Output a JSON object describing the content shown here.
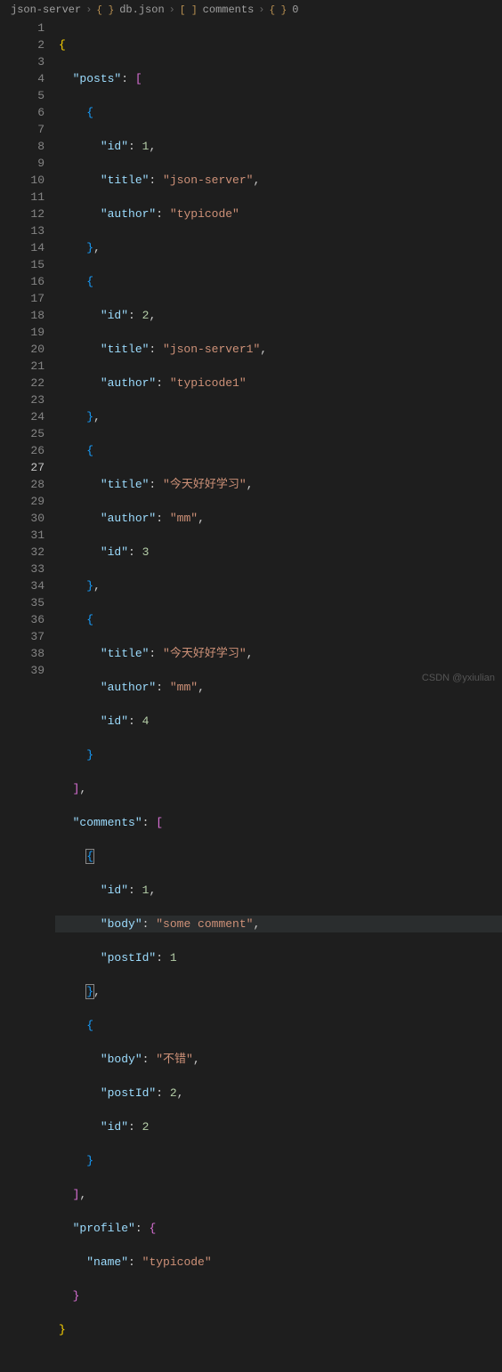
{
  "breadcrumbs": {
    "c0": "json-server",
    "c1": "db.json",
    "c2": "comments",
    "c3": "0"
  },
  "lines": {
    "k_posts": "\"posts\"",
    "k_comments": "\"comments\"",
    "k_profile": "\"profile\"",
    "k_id": "\"id\"",
    "k_title": "\"title\"",
    "k_author": "\"author\"",
    "k_body": "\"body\"",
    "k_postId": "\"postId\"",
    "k_name": "\"name\"",
    "v_json_server": "\"json-server\"",
    "v_typicode": "\"typicode\"",
    "v_json_server1": "\"json-server1\"",
    "v_typicode1": "\"typicode1\"",
    "v_study": "\"今天好好学习\"",
    "v_mm": "\"mm\"",
    "v_some_comment": "\"some comment\"",
    "v_notbad": "\"不错\"",
    "n1": "1",
    "n2": "2",
    "n3": "3",
    "n4": "4"
  },
  "gutter": [
    "1",
    "2",
    "3",
    "4",
    "5",
    "6",
    "7",
    "8",
    "9",
    "10",
    "11",
    "12",
    "13",
    "14",
    "15",
    "16",
    "17",
    "18",
    "19",
    "20",
    "21",
    "22",
    "23",
    "24",
    "25",
    "26",
    "27",
    "28",
    "29",
    "30",
    "31",
    "32",
    "33",
    "34",
    "35",
    "36",
    "37",
    "38",
    "39"
  ],
  "watermark": "CSDN @yxiulian",
  "file_content": {
    "posts": [
      {
        "id": 1,
        "title": "json-server",
        "author": "typicode"
      },
      {
        "id": 2,
        "title": "json-server1",
        "author": "typicode1"
      },
      {
        "title": "今天好好学习",
        "author": "mm",
        "id": 3
      },
      {
        "title": "今天好好学习",
        "author": "mm",
        "id": 4
      }
    ],
    "comments": [
      {
        "id": 1,
        "body": "some comment",
        "postId": 1
      },
      {
        "body": "不错",
        "postId": 2,
        "id": 2
      }
    ],
    "profile": {
      "name": "typicode"
    }
  }
}
